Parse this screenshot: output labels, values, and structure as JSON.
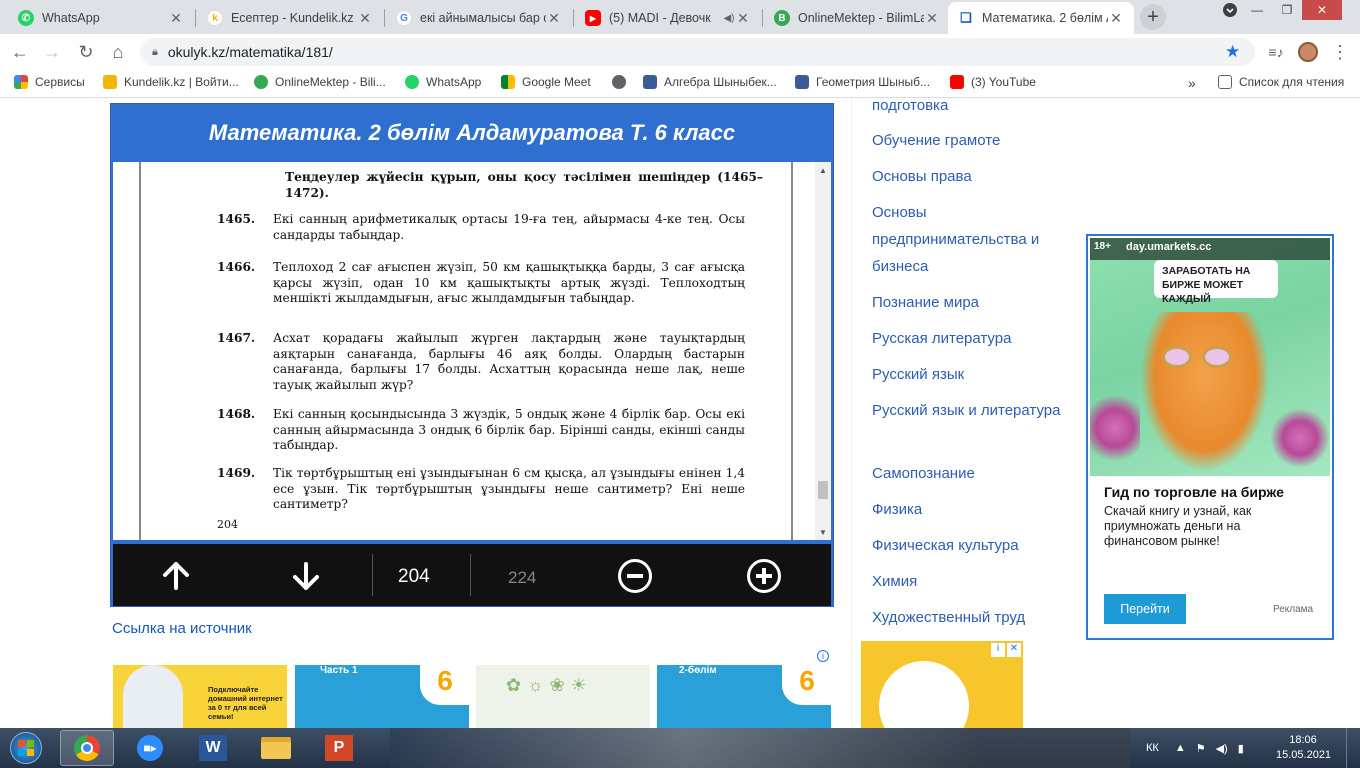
{
  "browser": {
    "tabs": [
      {
        "title": "WhatsApp",
        "icon": "whatsapp-icon",
        "color": "#25d366",
        "active": false
      },
      {
        "title": "Есептер - Kundelik.kz",
        "icon": "kundelik-icon",
        "color": "#f4b400",
        "active": false
      },
      {
        "title": "екі айнымалысы бар с",
        "icon": "google-icon",
        "color": "#4285f4",
        "active": false
      },
      {
        "title": "(5) MADI - Девочк",
        "icon": "youtube-icon",
        "color": "#ff0000",
        "active": false
      },
      {
        "title": "OnlineMektep - BilimLa",
        "icon": "onlinemektep-icon",
        "color": "#34a853",
        "active": false
      },
      {
        "title": "Математика. 2 бөлім А",
        "icon": "book-icon",
        "color": "#1a57b7",
        "active": true
      }
    ],
    "url": "okulyk.kz/matematika/181/",
    "bookmarks": [
      {
        "label": "Сервисы",
        "icon": "apps-icon"
      },
      {
        "label": "Kundelik.kz | Войти...",
        "icon": "kundelik-icon"
      },
      {
        "label": "OnlineMektep - Bili...",
        "icon": "onlinemektep-icon"
      },
      {
        "label": "WhatsApp",
        "icon": "whatsapp-icon"
      },
      {
        "label": "Google Meet",
        "icon": "meet-icon"
      },
      {
        "label": "",
        "icon": "globe-icon"
      },
      {
        "label": "Алгебра Шыныбек...",
        "icon": "book-icon"
      },
      {
        "label": "Геометрия Шыныб...",
        "icon": "book-icon"
      },
      {
        "label": "(3) YouTube",
        "icon": "youtube-icon"
      }
    ],
    "overflow_label": "»",
    "reading_list": "Список для чтения"
  },
  "viewer": {
    "title": "Математика. 2 бөлім Алдамуратова Т. 6 класс",
    "intro": "Теңдеулер жүйесін құрып, оны қосу тәсілімен шешіңдер (1465–1472).",
    "problems": [
      {
        "num": "1465.",
        "text": "Екі санның арифметикалық ортасы 19-ға тең, айырмасы 4-ке тең. Осы сандарды табыңдар."
      },
      {
        "num": "1466.",
        "text": "Теплоход 2 сағ ағыспен жүзіп, 50 км қашықтыққа барды, 3 сағ ағысқа қарсы жүзіп, одан 10 км қашықтықты артық жүзді. Теплоходтың меншікті жылдамдығын, ағыс жылдамдығын табыңдар."
      },
      {
        "num": "1467.",
        "text": "Асхат қорадағы жайылып жүрген лақтардың және тауықтардың аяқтарын санағанда, барлығы 46 аяқ болды. Олардың бастарын санағанда, барлығы 17 болды. Асхаттың қорасында неше лақ, неше тауық жайылып жүр?"
      },
      {
        "num": "1468.",
        "text": "Екі санның қосындысында 3 жүздік, 5 ондық және 4 бірлік бар. Осы екі санның айырмасында 3 ондық 6 бірлік бар. Бірінші санды, екінші санды табыңдар."
      },
      {
        "num": "1469.",
        "text": "Тік төртбұрыштың ені ұзындығынан 6 см қысқа, ал ұзындығы енінен 1,4 есе ұзын. Тік төртбұрыштың ұзындығы неше сантиметр? Ені неше сантиметр?"
      }
    ],
    "page_footer": "204",
    "current_page": "204",
    "total_pages": "224"
  },
  "source_link": "Ссылка на источник",
  "sidebar": {
    "items": [
      "подготовка",
      "Обучение грамоте",
      "Основы права",
      "Основы предпринимательства и бизнеса",
      "Познание мира",
      "Русская литература",
      "Русский язык",
      "Русский язык и литература",
      "Самопознание",
      "Физика",
      "Физическая культура",
      "Химия",
      "Художественный труд"
    ]
  },
  "ad": {
    "age": "18+",
    "domain": "day.umarkets.cc",
    "headline": "ЗАРАБОТАТЬ НА БИРЖЕ МОЖЕТ КАЖДЫЙ",
    "title": "Гид по торговле на бирже",
    "text": "Скачай книгу и узнай, как приумножать деньги на финансовом рынке!",
    "button": "Перейти",
    "label": "Реклама"
  },
  "thumbs": {
    "promo": "Подключайте домашний интернет за 0 тг для всей семьи!",
    "book1": "Часть 1",
    "book2": "2-бөлім",
    "grade": "6"
  },
  "taskbar": {
    "lang": "КК",
    "time": "18:06",
    "date": "15.05.2021"
  }
}
